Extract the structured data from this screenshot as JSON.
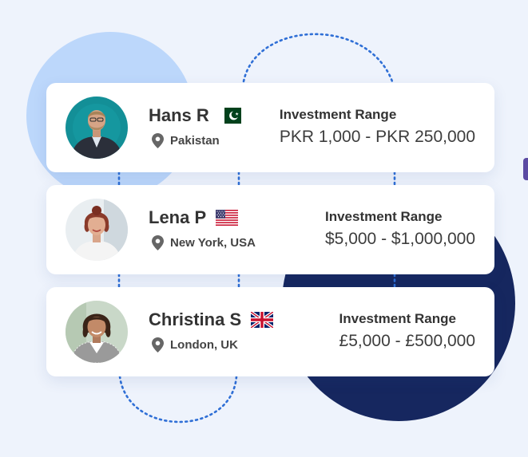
{
  "theme": {
    "accent": "#2f6fd6",
    "dark_circle": "#16275f",
    "light_circle": "#bcd7fb"
  },
  "investors": [
    {
      "name": "Hans R",
      "flag": "pakistan-flag",
      "location": "Pakistan",
      "range_label": "Investment Range",
      "range": "PKR 1,000 - PKR 250,000"
    },
    {
      "name": "Lena P",
      "flag": "usa-flag",
      "location": "New York, USA",
      "range_label": "Investment Range",
      "range": "$5,000 - $1,000,000"
    },
    {
      "name": "Christina S",
      "flag": "uk-flag",
      "location": "London, UK",
      "range_label": "Investment Range",
      "range": "£5,000 - £500,000"
    }
  ]
}
